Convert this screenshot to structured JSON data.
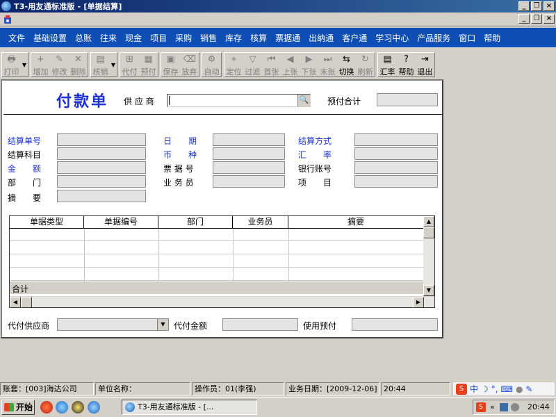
{
  "window": {
    "title": "T3-用友通标准版 - [单据结算]",
    "minimize": "_",
    "restore": "❐",
    "close": "×"
  },
  "menu": [
    "文件",
    "基础设置",
    "总账",
    "往来",
    "现金",
    "项目",
    "采购",
    "销售",
    "库存",
    "核算",
    "票据通",
    "出纳通",
    "客户通",
    "学习中心",
    "产品服务",
    "窗口",
    "帮助"
  ],
  "toolbar": {
    "groups": [
      [
        {
          "label": "打印",
          "icon": "printer-icon",
          "glyph": "🖶",
          "enabled": false,
          "dropdown": true
        }
      ],
      [
        {
          "label": "增加",
          "icon": "add-icon",
          "glyph": "+",
          "enabled": false
        },
        {
          "label": "修改",
          "icon": "edit-icon",
          "glyph": "✎",
          "enabled": false
        },
        {
          "label": "删除",
          "icon": "delete-icon",
          "glyph": "✕",
          "enabled": false
        }
      ],
      [
        {
          "label": "核销",
          "icon": "verify-icon",
          "glyph": "▤",
          "enabled": false,
          "dropdown": true
        }
      ],
      [
        {
          "label": "代付",
          "icon": "pay-for-icon",
          "glyph": "⊞",
          "enabled": false
        },
        {
          "label": "预付",
          "icon": "prepay-icon",
          "glyph": "▦",
          "enabled": false
        }
      ],
      [
        {
          "label": "保存",
          "icon": "save-icon",
          "glyph": "▣",
          "enabled": false
        },
        {
          "label": "放弃",
          "icon": "discard-icon",
          "glyph": "⌫",
          "enabled": false
        }
      ],
      [
        {
          "label": "自动",
          "icon": "auto-icon",
          "glyph": "⚙",
          "enabled": false
        }
      ],
      [
        {
          "label": "定位",
          "icon": "locate-icon",
          "glyph": "⌖",
          "enabled": false
        },
        {
          "label": "过滤",
          "icon": "filter-icon",
          "glyph": "▽",
          "enabled": false
        },
        {
          "label": "首张",
          "icon": "first-icon",
          "glyph": "⏮",
          "enabled": false
        },
        {
          "label": "上张",
          "icon": "prev-icon",
          "glyph": "◀",
          "enabled": false
        },
        {
          "label": "下张",
          "icon": "next-icon",
          "glyph": "▶",
          "enabled": false
        },
        {
          "label": "末张",
          "icon": "last-icon",
          "glyph": "⏭",
          "enabled": false
        },
        {
          "label": "切换",
          "icon": "switch-icon",
          "glyph": "⇆",
          "enabled": true
        },
        {
          "label": "刷新",
          "icon": "refresh-icon",
          "glyph": "↻",
          "enabled": false
        }
      ],
      [
        {
          "label": "汇率",
          "icon": "exchange-rate-icon",
          "glyph": "▤",
          "enabled": true
        },
        {
          "label": "帮助",
          "icon": "help-icon",
          "glyph": "?",
          "enabled": true
        },
        {
          "label": "退出",
          "icon": "exit-icon",
          "glyph": "⇥",
          "enabled": true
        }
      ]
    ]
  },
  "form": {
    "title": "付款单",
    "supplier_label": "供 应 商",
    "supplier_value": "",
    "lookup_glyph": "🔍",
    "prepay_total_label": "预付合计",
    "fields": {
      "settle_no": "结算单号",
      "date": "日　　期",
      "settle_method": "结算方式",
      "settle_subject": "结算科目",
      "currency": "币　　种",
      "exchange_rate": "汇　　率",
      "amount": "金　　额",
      "bill_no": "票 据 号",
      "bank_account": "银行账号",
      "department": "部　　门",
      "salesman": "业 务 员",
      "project": "项　　目",
      "memo": "摘　　要"
    },
    "bottom": {
      "agent_supplier": "代付供应商",
      "agent_amount": "代付金额",
      "use_prepay": "使用预付"
    }
  },
  "grid": {
    "columns": [
      "单据类型",
      "单据编号",
      "部门",
      "业务员",
      "摘要"
    ],
    "total_label": "合计"
  },
  "status": {
    "account": "账套：[003]海达公司",
    "unit": "单位名称：",
    "operator": "操作员：01(李强)",
    "biz_date": "业务日期：[2009-12-06]",
    "time": "20:44"
  },
  "taskbar": {
    "start": "开始",
    "task": "T3-用友通标准版 - [...",
    "clock": "20:44"
  }
}
